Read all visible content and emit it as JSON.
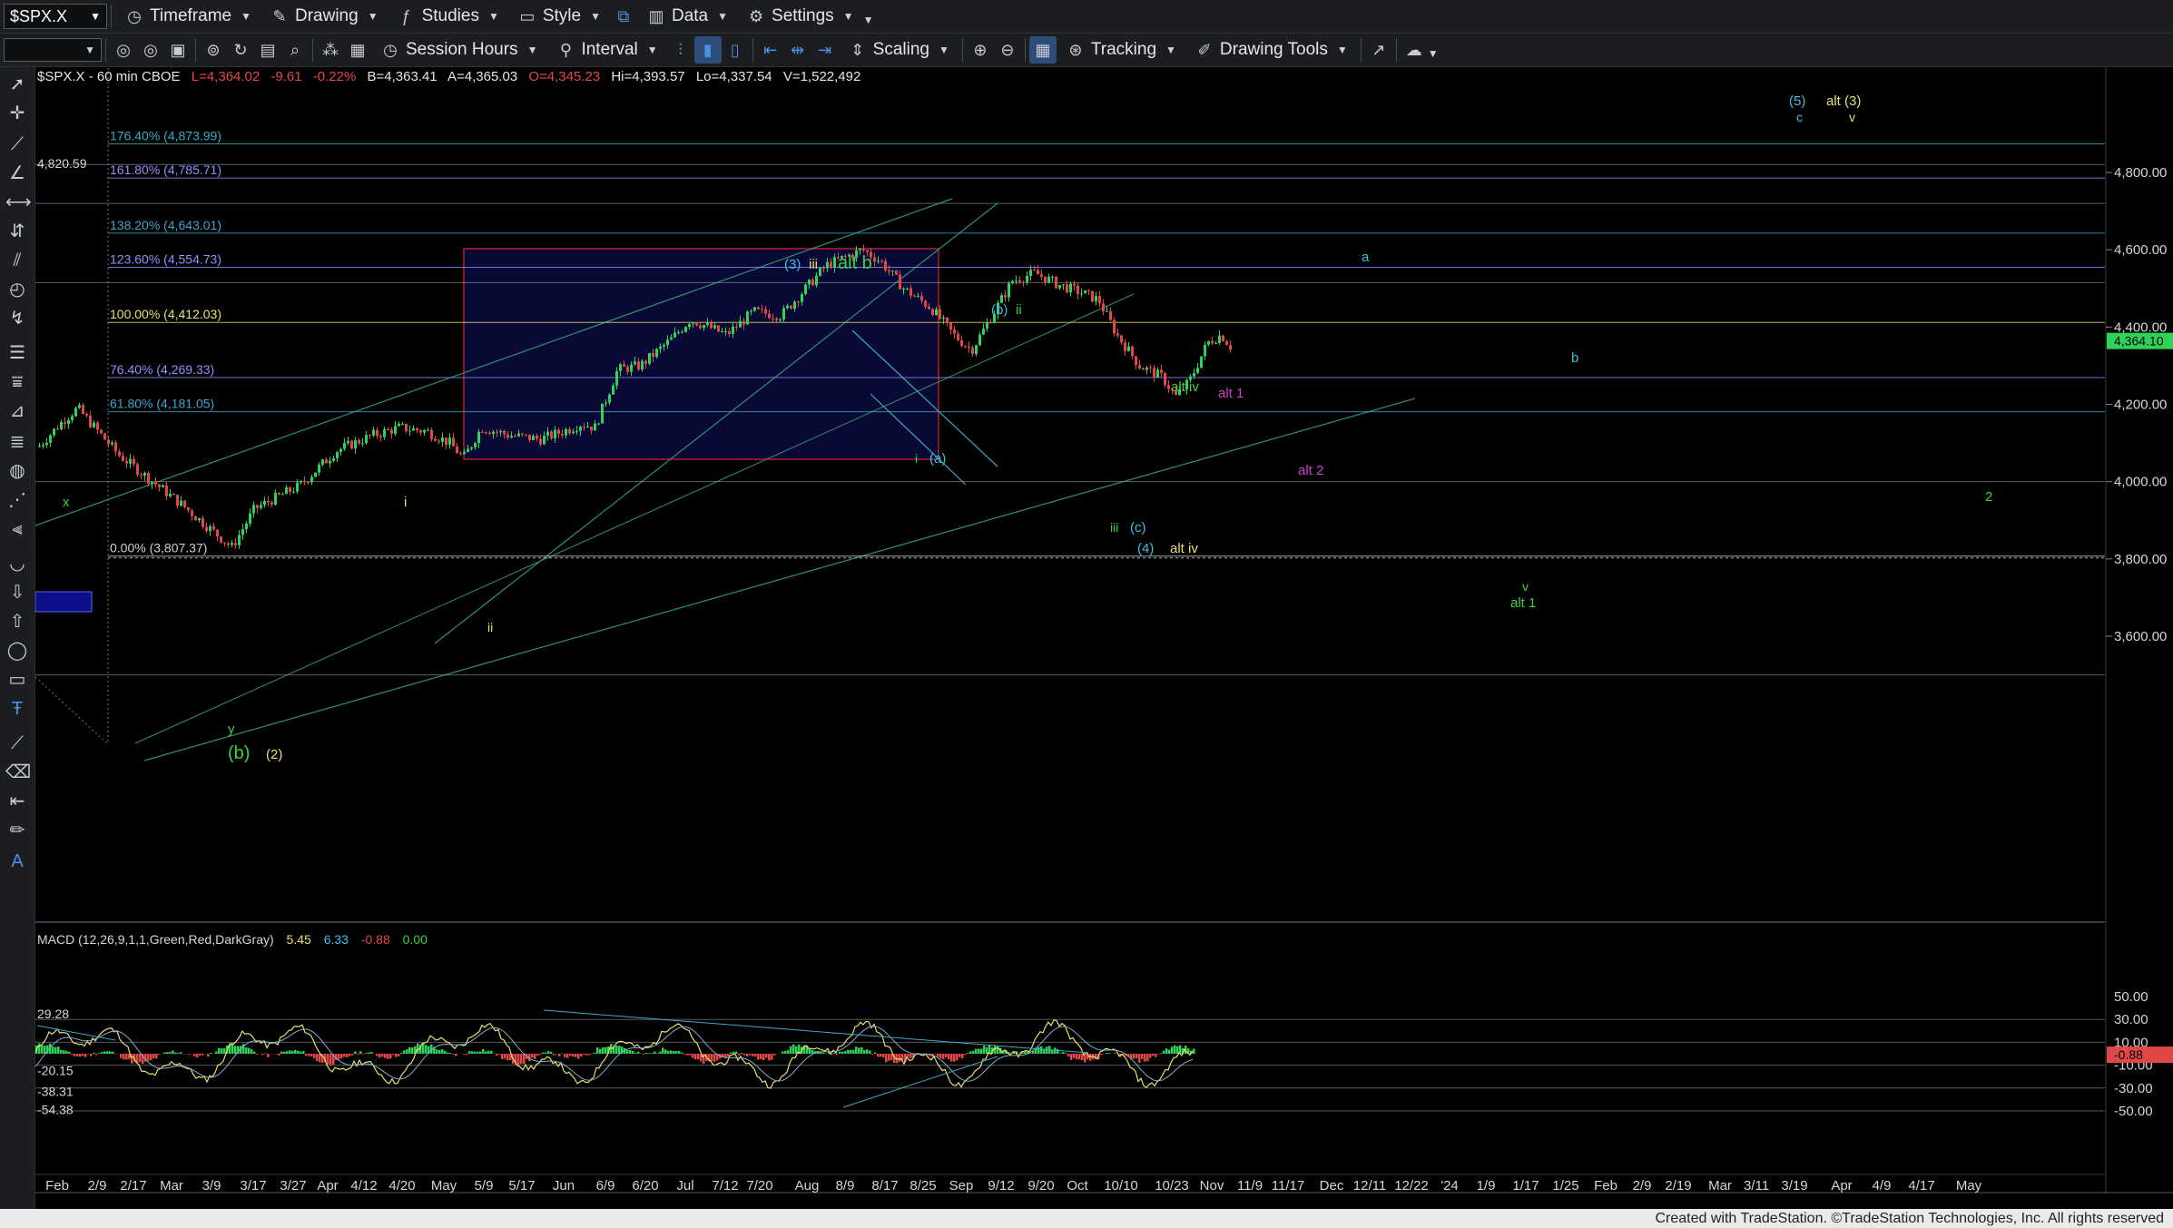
{
  "toolbar1": {
    "symbol": "$SPX.X",
    "items": [
      {
        "label": "Timeframe",
        "icon": "clock-icon"
      },
      {
        "label": "Drawing",
        "icon": "pencil-icon"
      },
      {
        "label": "Studies",
        "icon": "studies-icon"
      },
      {
        "label": "Style",
        "icon": "style-icon"
      },
      {
        "label": "Data",
        "icon": "data-icon"
      },
      {
        "label": "Settings",
        "icon": "gear-icon"
      }
    ]
  },
  "toolbar2": {
    "session_hours": "Session Hours",
    "interval": "Interval",
    "scaling": "Scaling",
    "tracking": "Tracking",
    "drawing_tools": "Drawing Tools"
  },
  "header": {
    "symbol_line": "$SPX.X - 60 min  CBOE",
    "last": "L=4,364.02",
    "change": "-9.61",
    "pct": "-0.22%",
    "bid": "B=4,363.41",
    "ask": "A=4,365.03",
    "open": "O=4,345.23",
    "high": "Hi=4,393.57",
    "low": "Lo=4,337.54",
    "volume": "V=1,522,492"
  },
  "chart_data": {
    "type": "candlestick",
    "title": "$SPX.X - 60 min CBOE",
    "colors": {
      "up": "#2fd35a",
      "down": "#e04848",
      "background": "#000000"
    },
    "price_axis": {
      "ticks": [
        4800,
        4600,
        4400,
        4200,
        4000,
        3800,
        3600
      ],
      "tick_labels": [
        "4,800.00",
        "4,600.00",
        "4,400.00",
        "4,200.00",
        "4,000.00",
        "3,800.00",
        "3,600.00"
      ],
      "last_price_label": "4,364.10",
      "ylim": [
        3500,
        5000
      ]
    },
    "x_axis_labels": [
      "Feb",
      "2/9",
      "2/17",
      "Mar",
      "3/9",
      "3/17",
      "3/27",
      "Apr",
      "4/12",
      "4/20",
      "May",
      "5/9",
      "5/17",
      "Jun",
      "6/9",
      "6/20",
      "Jul",
      "7/12",
      "7/20",
      "Aug",
      "8/9",
      "8/17",
      "8/25",
      "Sep",
      "9/12",
      "9/20",
      "Oct",
      "10/10",
      "10/23",
      "Nov",
      "11/9",
      "11/17",
      "Dec",
      "12/11",
      "12/22",
      "'24",
      "1/9",
      "1/17",
      "1/25",
      "Feb",
      "2/9",
      "2/19",
      "Mar",
      "3/11",
      "3/19",
      "Apr",
      "4/9",
      "4/17",
      "May"
    ],
    "fib_levels": [
      {
        "label": "176.40% (4,873.99)",
        "value": 4873.99,
        "color": "#3aa8c8"
      },
      {
        "label": "161.80% (4,785.71)",
        "value": 4785.71,
        "color": "#9090ff"
      },
      {
        "label": "138.20% (4,643.01)",
        "value": 4643.01,
        "color": "#3aa8c8"
      },
      {
        "label": "123.60% (4,554.73)",
        "value": 4554.73,
        "color": "#9090ff"
      },
      {
        "label": "100.00% (4,412.03)",
        "value": 4412.03,
        "color": "#e8e070"
      },
      {
        "label": "76.40% (4,269.33)",
        "value": 4269.33,
        "color": "#9090ff"
      },
      {
        "label": "61.80% (4,181.05)",
        "value": 4181.05,
        "color": "#3aa8c8"
      },
      {
        "label": "0.00% (3,807.37)",
        "value": 3807.37,
        "color": "#d0d0d0"
      }
    ],
    "side_label": "4,820.59",
    "wave_labels": [
      {
        "text": "(5)",
        "color": "#3ac0e0"
      },
      {
        "text": "alt (3)",
        "color": "#e8e070"
      },
      {
        "text": "c",
        "color": "#3ac0e0"
      },
      {
        "text": "v",
        "color": "#e8e070"
      },
      {
        "text": "(3)",
        "color": "#3ac0e0"
      },
      {
        "text": "iii",
        "color": "#e8e070"
      },
      {
        "text": "alt b",
        "color": "#3cd040"
      },
      {
        "text": "(b)",
        "color": "#3ac0e0"
      },
      {
        "text": "ii",
        "color": "#3cd040"
      },
      {
        "text": "a",
        "color": "#3ac0e0"
      },
      {
        "text": "b",
        "color": "#3ac0e0"
      },
      {
        "text": "alt iv",
        "color": "#3cd040"
      },
      {
        "text": "alt 1",
        "color": "#d040d0"
      },
      {
        "text": "alt 2",
        "color": "#d040d0"
      },
      {
        "text": "2",
        "color": "#3cd040"
      },
      {
        "text": "x",
        "color": "#3cd040"
      },
      {
        "text": "i",
        "color": "#e8e070"
      },
      {
        "text": "i",
        "color": "#3cd040"
      },
      {
        "text": "(a)",
        "color": "#3ac0e0"
      },
      {
        "text": "iii",
        "color": "#3cd040"
      },
      {
        "text": "(c)",
        "color": "#3ac0e0"
      },
      {
        "text": "(4)",
        "color": "#3ac0e0"
      },
      {
        "text": "alt iv",
        "color": "#e8e070"
      },
      {
        "text": "v",
        "color": "#3cd040"
      },
      {
        "text": "alt 1",
        "color": "#3cd040"
      },
      {
        "text": "ii",
        "color": "#e8e070"
      },
      {
        "text": "y",
        "color": "#3cd040"
      },
      {
        "text": "(b)",
        "color": "#3cd040"
      },
      {
        "text": "(2)",
        "color": "#e8e070"
      }
    ],
    "macd": {
      "label": "MACD (12,26,9,1,1,Green,Red,DarkGray)",
      "values": [
        "5.45",
        "6.33",
        "-0.88",
        "0.00"
      ],
      "value_colors": [
        "#e8e070",
        "#3ac0e0",
        "#e04848",
        "#3cd040"
      ],
      "axis_ticks": [
        "50.00",
        "30.00",
        "10.00",
        "-10.00",
        "-30.00",
        "-50.00"
      ],
      "last_label": "-0.88",
      "left_levels": [
        "29.28",
        "-20.15",
        "-38.31",
        "-54.38"
      ]
    }
  },
  "footer": "Created with TradeStation. ©TradeStation Technologies, Inc. All rights reserved"
}
